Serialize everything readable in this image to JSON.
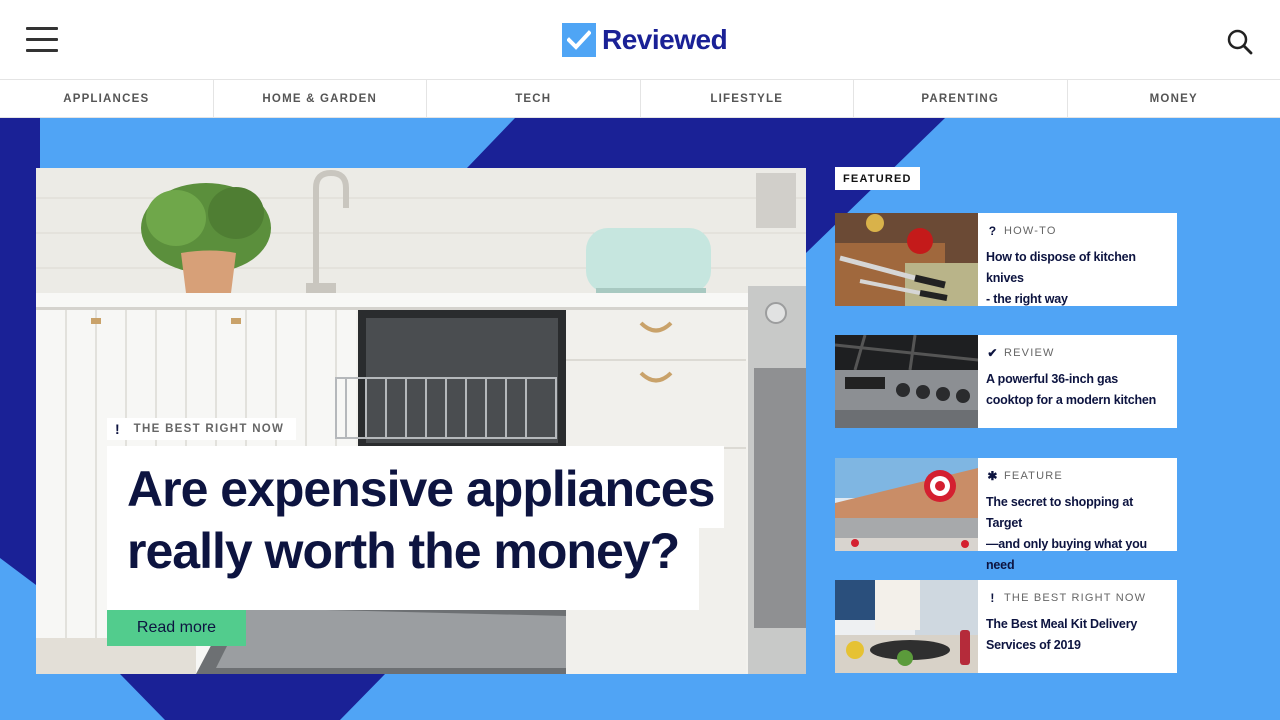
{
  "brand": {
    "name": "Reviewed",
    "logo_color": "#4fa5f5",
    "text_color": "#1a2196"
  },
  "header": {
    "menu_icon": "hamburger-menu-icon",
    "search_icon": "search-icon"
  },
  "nav": {
    "items": [
      {
        "label": "APPLIANCES"
      },
      {
        "label": "HOME & GARDEN"
      },
      {
        "label": "TECH"
      },
      {
        "label": "LIFESTYLE"
      },
      {
        "label": "PARENTING"
      },
      {
        "label": "MONEY"
      }
    ]
  },
  "hero": {
    "tag": "THE BEST RIGHT NOW",
    "tag_icon": "exclamation-icon",
    "headline_line1": "Are expensive appliances",
    "headline_line2": "really worth the money?",
    "cta": "Read more",
    "colors": {
      "background": "#50a4f5",
      "accent_dark": "#1a2196",
      "cta": "#52cc8d"
    }
  },
  "featured": {
    "label": "FEATURED",
    "cards": [
      {
        "kind": "HOW-TO",
        "icon": "question-icon",
        "title_line1": "How to dispose of kitchen knives",
        "title_line2": "- the right way"
      },
      {
        "kind": "REVIEW",
        "icon": "checkmark-icon",
        "title_line1": "A powerful 36-inch gas",
        "title_line2": "cooktop for a modern kitchen"
      },
      {
        "kind": "FEATURE",
        "icon": "star-icon",
        "title_line1": "The secret to shopping at Target",
        "title_line2": "—and only buying what you need"
      },
      {
        "kind": "THE BEST RIGHT NOW",
        "icon": "exclamation-icon",
        "title_line1": "The Best Meal Kit Delivery",
        "title_line2": "Services of 2019"
      }
    ]
  }
}
